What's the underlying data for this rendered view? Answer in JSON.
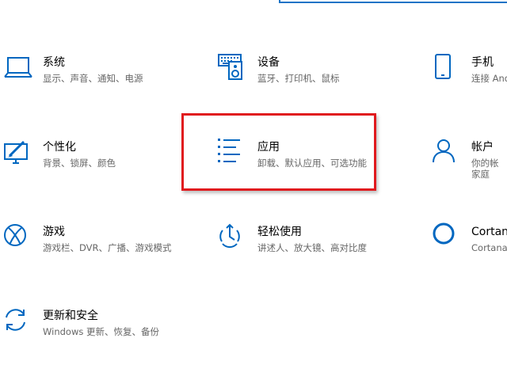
{
  "colors": {
    "accent": "#0067c0",
    "highlight": "#e0191e",
    "title_text": "#000000",
    "desc_text": "#666666"
  },
  "tiles": {
    "system": {
      "icon": "laptop-icon",
      "title": "系统",
      "desc": "显示、声音、通知、电源"
    },
    "devices": {
      "icon": "keyboard-speaker-icon",
      "title": "设备",
      "desc": "蓝牙、打印机、鼠标"
    },
    "phone": {
      "icon": "phone-icon",
      "title": "手机",
      "desc": "连接 And"
    },
    "personalization": {
      "icon": "paint-monitor-icon",
      "title": "个性化",
      "desc": "背景、锁屏、颜色"
    },
    "apps": {
      "icon": "apps-list-icon",
      "title": "应用",
      "desc": "卸载、默认应用、可选功能"
    },
    "accounts": {
      "icon": "person-icon",
      "title": "帐户",
      "desc_line1": "你的帐",
      "desc_line2": "家庭"
    },
    "gaming": {
      "icon": "xbox-icon",
      "title": "游戏",
      "desc": "游戏栏、DVR、广播、游戏模式"
    },
    "ease_of_access": {
      "icon": "ease-of-access-icon",
      "title": "轻松使用",
      "desc": "讲述人、放大镜、高对比度"
    },
    "cortana": {
      "icon": "cortana-circle-icon",
      "title": "Cortana",
      "desc": "Cortana"
    },
    "update_security": {
      "icon": "sync-arrows-icon",
      "title": "更新和安全",
      "desc": "Windows 更新、恢复、备份"
    }
  }
}
